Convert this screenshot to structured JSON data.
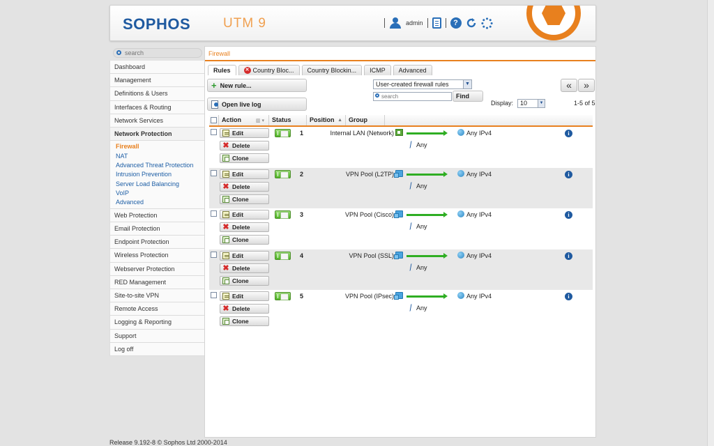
{
  "header": {
    "logo": "SOPHOS",
    "product": "UTM 9",
    "user": "admin"
  },
  "sidebar": {
    "search_placeholder": "search",
    "items": [
      {
        "label": "Dashboard"
      },
      {
        "label": "Management"
      },
      {
        "label": "Definitions & Users"
      },
      {
        "label": "Interfaces & Routing"
      },
      {
        "label": "Network Services"
      },
      {
        "label": "Network Protection"
      },
      {
        "label": "Web Protection"
      },
      {
        "label": "Email Protection"
      },
      {
        "label": "Endpoint Protection"
      },
      {
        "label": "Wireless Protection"
      },
      {
        "label": "Webserver Protection"
      },
      {
        "label": "RED Management"
      },
      {
        "label": "Site-to-site VPN"
      },
      {
        "label": "Remote Access"
      },
      {
        "label": "Logging & Reporting"
      },
      {
        "label": "Support"
      },
      {
        "label": "Log off"
      }
    ],
    "sub_items": [
      {
        "label": "Firewall"
      },
      {
        "label": "NAT"
      },
      {
        "label": "Advanced Threat Protection"
      },
      {
        "label": "Intrusion Prevention"
      },
      {
        "label": "Server Load Balancing"
      },
      {
        "label": "VoIP"
      },
      {
        "label": "Advanced"
      }
    ]
  },
  "page": {
    "title": "Firewall",
    "tabs": [
      {
        "label": "Rules"
      },
      {
        "label": "Country Bloc..."
      },
      {
        "label": "Country Blockin..."
      },
      {
        "label": "ICMP"
      },
      {
        "label": "Advanced"
      }
    ],
    "new_rule": "New rule...",
    "open_live_log": "Open live log",
    "filter_selected": "User-created firewall rules",
    "filter_search_placeholder": "search",
    "find": "Find",
    "display_label": "Display:",
    "display_value": "10",
    "range": "1-5 of 5",
    "prev": "«",
    "next": "»"
  },
  "table": {
    "headers": {
      "action": "Action",
      "status": "Status",
      "position": "Position",
      "group": "Group"
    },
    "buttons": {
      "edit": "Edit",
      "delete": "Delete",
      "clone": "Clone"
    },
    "rows": [
      {
        "position": "1",
        "source": "Internal LAN (Network)",
        "service": "Any",
        "destination": "Any IPv4",
        "enabled": true
      },
      {
        "position": "2",
        "source": "VPN Pool (L2TP)",
        "service": "Any",
        "destination": "Any IPv4",
        "enabled": true
      },
      {
        "position": "3",
        "source": "VPN Pool (Cisco)",
        "service": "Any",
        "destination": "Any IPv4",
        "enabled": true
      },
      {
        "position": "4",
        "source": "VPN Pool (SSL)",
        "service": "Any",
        "destination": "Any IPv4",
        "enabled": true
      },
      {
        "position": "5",
        "source": "VPN Pool (IPsec)",
        "service": "Any",
        "destination": "Any IPv4",
        "enabled": true
      }
    ]
  },
  "footer": {
    "text": "Release 9.192-8 © Sophos Ltd 2000-2014"
  },
  "colors": {
    "accent": "#e8801e",
    "brand": "#1f5aa0",
    "enabled": "#4fb325"
  }
}
